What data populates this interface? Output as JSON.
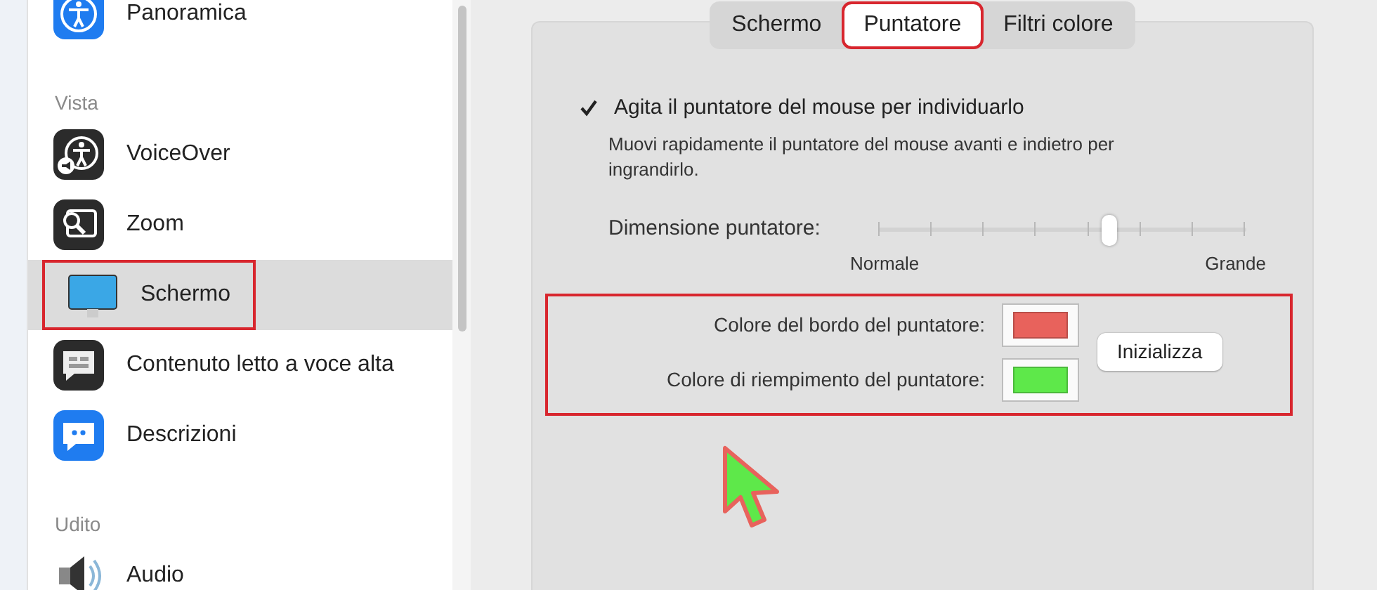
{
  "sidebar": {
    "items": [
      {
        "kind": "item",
        "label": "Panoramica",
        "selected": false,
        "highlighted": false
      },
      {
        "kind": "heading",
        "label": "Vista"
      },
      {
        "kind": "item",
        "label": "VoiceOver",
        "selected": false,
        "highlighted": false
      },
      {
        "kind": "item",
        "label": "Zoom",
        "selected": false,
        "highlighted": false
      },
      {
        "kind": "item",
        "label": "Schermo",
        "selected": true,
        "highlighted": true
      },
      {
        "kind": "item",
        "label": "Contenuto letto a voce alta",
        "selected": false,
        "highlighted": false
      },
      {
        "kind": "item",
        "label": "Descrizioni",
        "selected": false,
        "highlighted": false
      },
      {
        "kind": "heading",
        "label": "Udito"
      },
      {
        "kind": "item",
        "label": "Audio",
        "selected": false,
        "highlighted": false
      }
    ]
  },
  "tabs": [
    {
      "label": "Schermo",
      "selected": false,
      "highlighted": false
    },
    {
      "label": "Puntatore",
      "selected": true,
      "highlighted": true
    },
    {
      "label": "Filtri colore",
      "selected": false,
      "highlighted": false
    }
  ],
  "shake_option": {
    "label": "Agita il puntatore del mouse per individuarlo",
    "checked": true,
    "description": "Muovi rapidamente il puntatore del mouse avanti e indietro per ingrandirlo."
  },
  "pointer_size": {
    "label": "Dimensione puntatore:",
    "level": 0.63,
    "min_label": "Normale",
    "max_label": "Grande"
  },
  "pointer_colors": {
    "highlighted": true,
    "items": [
      {
        "label": "Colore del bordo del puntatore:",
        "color": "#e8625c"
      },
      {
        "label": "Colore di riempimento del puntatore:",
        "color": "#5ee84a"
      }
    ],
    "reset_button": "Inizializza"
  }
}
